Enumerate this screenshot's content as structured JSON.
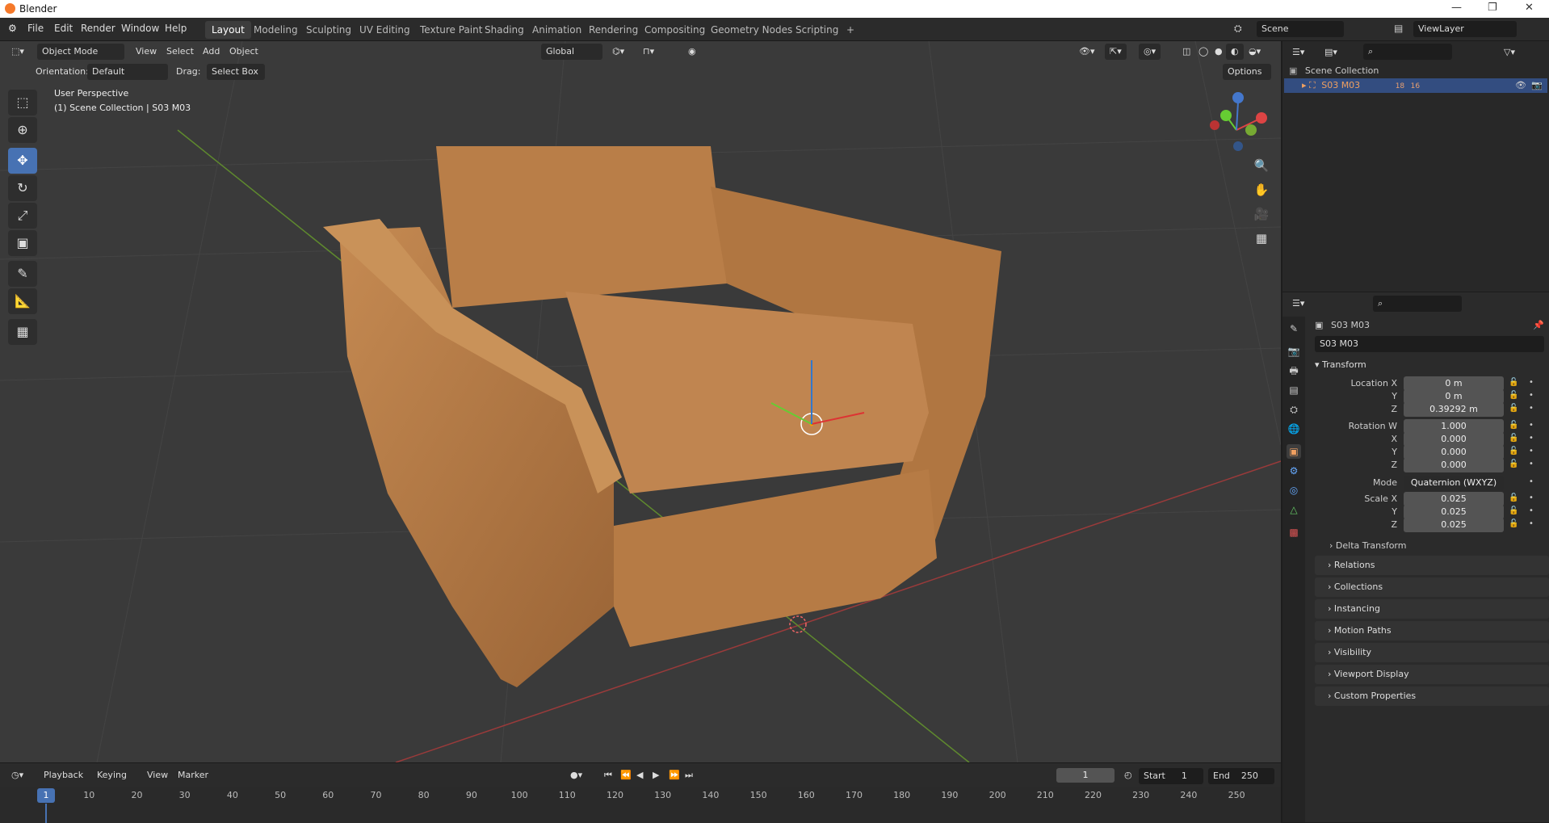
{
  "window": {
    "title": "Blender"
  },
  "menus": [
    "File",
    "Edit",
    "Render",
    "Window",
    "Help"
  ],
  "workspaces": [
    "Layout",
    "Modeling",
    "Sculpting",
    "UV Editing",
    "Texture Paint",
    "Shading",
    "Animation",
    "Rendering",
    "Compositing",
    "Geometry Nodes",
    "Scripting"
  ],
  "active_workspace": "Layout",
  "scene": {
    "name": "Scene",
    "view_layer": "ViewLayer"
  },
  "viewport": {
    "mode": "Object Mode",
    "menus": [
      "View",
      "Select",
      "Add",
      "Object"
    ],
    "transform_orientation": "Global",
    "orientation_label": "Orientation:",
    "orientation_value": "Default",
    "drag_label": "Drag:",
    "drag_value": "Select Box",
    "options_label": "Options",
    "perspective": "User Perspective",
    "context": "(1) Scene Collection | S03 M03",
    "gizmo_axes": [
      "X",
      "Y",
      "Z"
    ]
  },
  "outliner": {
    "root": "Scene Collection",
    "item": "S03 M03",
    "item_counts": [
      "18",
      "16"
    ]
  },
  "properties": {
    "object_name": "S03 M03",
    "data_name": "S03 M03",
    "transform_header": "Transform",
    "location": {
      "label": "Location X",
      "x": "0 m",
      "y": "0 m",
      "z": "0.39292 m"
    },
    "rotation": {
      "label": "Rotation W",
      "w": "1.000",
      "x": "0.000",
      "y": "0.000",
      "z": "0.000"
    },
    "mode_label": "Mode",
    "mode_value": "Quaternion (WXYZ)",
    "scale": {
      "label": "Scale X",
      "x": "0.025",
      "y": "0.025",
      "z": "0.025"
    },
    "axis_labels": {
      "y": "Y",
      "z": "Z",
      "x": "X"
    },
    "subpanel": "Delta Transform",
    "panels": [
      "Relations",
      "Collections",
      "Instancing",
      "Motion Paths",
      "Visibility",
      "Viewport Display",
      "Custom Properties"
    ]
  },
  "timeline": {
    "menus": [
      "Playback",
      "Keying",
      "View",
      "Marker"
    ],
    "current_frame": "1",
    "start_label": "Start",
    "start": "1",
    "end_label": "End",
    "end": "250",
    "ruler": [
      "1",
      "10",
      "20",
      "30",
      "40",
      "50",
      "60",
      "70",
      "80",
      "90",
      "100",
      "110",
      "120",
      "130",
      "140",
      "150",
      "160",
      "170",
      "180",
      "190",
      "200",
      "210",
      "220",
      "230",
      "240",
      "250"
    ]
  },
  "colors": {
    "accent": "#4772b3",
    "selected_row": "#334d80",
    "x_axis": "#c0392b",
    "y_axis": "#7ab33c",
    "z_axis": "#3c7ad6",
    "leather": "#b57a45"
  }
}
